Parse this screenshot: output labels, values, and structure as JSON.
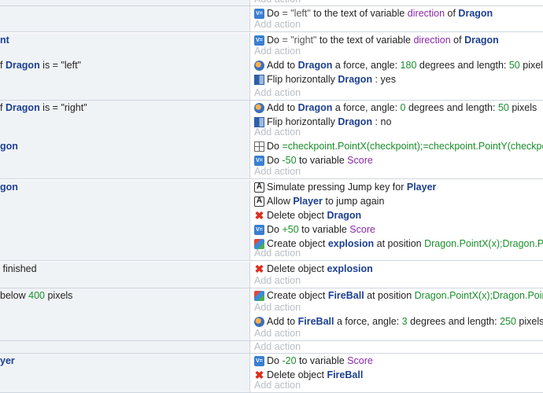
{
  "add_action_label": "Add action",
  "top_stub": {
    "add": "Add action"
  },
  "events": [
    {
      "cond": [],
      "actions": [
        {
          "icon": "variable-icon",
          "parts": [
            {
              "t": "Do "
            },
            {
              "t": "= ",
              "c": "str"
            },
            {
              "t": "\"left\"",
              "c": "str"
            },
            {
              "t": " to the text of variable "
            },
            {
              "t": "direction",
              "c": "var"
            },
            {
              "t": " of "
            },
            {
              "t": "Dragon",
              "c": "obj"
            }
          ]
        }
      ]
    },
    {
      "cond": [
        {
          "parts": [
            {
              "t": "nt",
              "c": "obj"
            }
          ]
        }
      ],
      "actions": [
        {
          "icon": "variable-icon",
          "parts": [
            {
              "t": "Do "
            },
            {
              "t": "= ",
              "c": "str"
            },
            {
              "t": "\"right\"",
              "c": "str"
            },
            {
              "t": " to the text of variable "
            },
            {
              "t": "direction",
              "c": "var"
            },
            {
              "t": " of "
            },
            {
              "t": "Dragon",
              "c": "obj"
            }
          ]
        }
      ]
    },
    {
      "cond": [
        {
          "parts": [
            {
              "t": "f "
            },
            {
              "t": "Dragon",
              "c": "obj"
            },
            {
              "t": " is = \"left\""
            }
          ]
        }
      ],
      "actions": [
        {
          "icon": "force-icon",
          "parts": [
            {
              "t": "Add to "
            },
            {
              "t": "Dragon",
              "c": "obj"
            },
            {
              "t": " a force, angle: "
            },
            {
              "t": "180",
              "c": "num"
            },
            {
              "t": " degrees and length: "
            },
            {
              "t": "50",
              "c": "num"
            },
            {
              "t": " pixels"
            }
          ]
        },
        {
          "icon": "flip-icon",
          "parts": [
            {
              "t": "Flip horizontally "
            },
            {
              "t": "Dragon",
              "c": "obj"
            },
            {
              "t": " : yes"
            }
          ]
        }
      ]
    },
    {
      "cond": [
        {
          "parts": [
            {
              "t": "f "
            },
            {
              "t": "Dragon",
              "c": "obj"
            },
            {
              "t": " is = \"right\""
            }
          ]
        }
      ],
      "actions": [
        {
          "icon": "force-icon",
          "parts": [
            {
              "t": "Add to "
            },
            {
              "t": "Dragon",
              "c": "obj"
            },
            {
              "t": " a force, angle: "
            },
            {
              "t": "0",
              "c": "num"
            },
            {
              "t": " degrees and length: "
            },
            {
              "t": "50",
              "c": "num"
            },
            {
              "t": " pixels"
            }
          ]
        },
        {
          "icon": "flip-icon",
          "parts": [
            {
              "t": "Flip horizontally "
            },
            {
              "t": "Dragon",
              "c": "obj"
            },
            {
              "t": " : no"
            }
          ]
        }
      ]
    },
    {
      "cond": [
        {
          "parts": [
            {
              "t": "gon",
              "c": "obj"
            }
          ]
        }
      ],
      "actions": [
        {
          "icon": "position-icon",
          "parts": [
            {
              "t": "Do "
            },
            {
              "t": "=checkpoint.PointX(checkpoint);=checkpoint.PointY(checkpoi",
              "c": "expr"
            }
          ]
        },
        {
          "icon": "variable-icon",
          "parts": [
            {
              "t": "Do "
            },
            {
              "t": "-50",
              "c": "num"
            },
            {
              "t": " to variable "
            },
            {
              "t": "Score",
              "c": "var"
            }
          ]
        }
      ]
    },
    {
      "cond": [
        {
          "parts": [
            {
              "t": "gon",
              "c": "obj"
            }
          ]
        }
      ],
      "actions": [
        {
          "icon": "key-icon",
          "parts": [
            {
              "t": "Simulate pressing Jump key for "
            },
            {
              "t": "Player",
              "c": "obj"
            }
          ]
        },
        {
          "icon": "key-icon",
          "parts": [
            {
              "t": "Allow "
            },
            {
              "t": "Player",
              "c": "obj"
            },
            {
              "t": " to jump again"
            }
          ]
        },
        {
          "icon": "delete-icon",
          "parts": [
            {
              "t": "Delete object "
            },
            {
              "t": "Dragon",
              "c": "obj"
            }
          ]
        },
        {
          "icon": "variable-icon",
          "parts": [
            {
              "t": "Do "
            },
            {
              "t": "+50",
              "c": "num"
            },
            {
              "t": " to variable "
            },
            {
              "t": "Score",
              "c": "var"
            }
          ]
        },
        {
          "icon": "create-icon",
          "parts": [
            {
              "t": "Create object "
            },
            {
              "t": "explosion",
              "c": "obj"
            },
            {
              "t": " at position "
            },
            {
              "t": "Dragon.PointX(x);Dragon.Po",
              "c": "expr"
            }
          ]
        }
      ]
    },
    {
      "cond": [
        {
          "parts": [
            {
              "t": " finished"
            }
          ]
        }
      ],
      "actions": [
        {
          "icon": "delete-icon",
          "parts": [
            {
              "t": "Delete object "
            },
            {
              "t": "explosion",
              "c": "obj"
            }
          ]
        }
      ]
    },
    {
      "cond": [
        {
          "parts": [
            {
              "t": "below "
            },
            {
              "t": "400",
              "c": "num"
            },
            {
              "t": " pixels"
            }
          ]
        }
      ],
      "actions": [
        {
          "icon": "create-icon",
          "parts": [
            {
              "t": "Create object "
            },
            {
              "t": "FireBall",
              "c": "obj"
            },
            {
              "t": " at position "
            },
            {
              "t": "Dragon.PointX(x);Dragon.Point",
              "c": "expr"
            }
          ]
        }
      ]
    },
    {
      "cond": [],
      "actions": [
        {
          "icon": "force-icon",
          "parts": [
            {
              "t": "Add to "
            },
            {
              "t": "FireBall",
              "c": "obj"
            },
            {
              "t": " a force, angle: "
            },
            {
              "t": "3",
              "c": "num"
            },
            {
              "t": " degrees and length: "
            },
            {
              "t": "250",
              "c": "num"
            },
            {
              "t": " pixels"
            }
          ]
        }
      ]
    },
    {
      "cond": [],
      "actions": []
    },
    {
      "cond": [
        {
          "parts": [
            {
              "t": "yer",
              "c": "obj"
            }
          ]
        }
      ],
      "actions": [
        {
          "icon": "variable-icon",
          "parts": [
            {
              "t": "Do "
            },
            {
              "t": "-20",
              "c": "num"
            },
            {
              "t": " to variable "
            },
            {
              "t": "Score",
              "c": "var"
            }
          ]
        },
        {
          "icon": "delete-icon",
          "parts": [
            {
              "t": "Delete object "
            },
            {
              "t": "FireBall",
              "c": "obj"
            }
          ]
        }
      ]
    }
  ]
}
